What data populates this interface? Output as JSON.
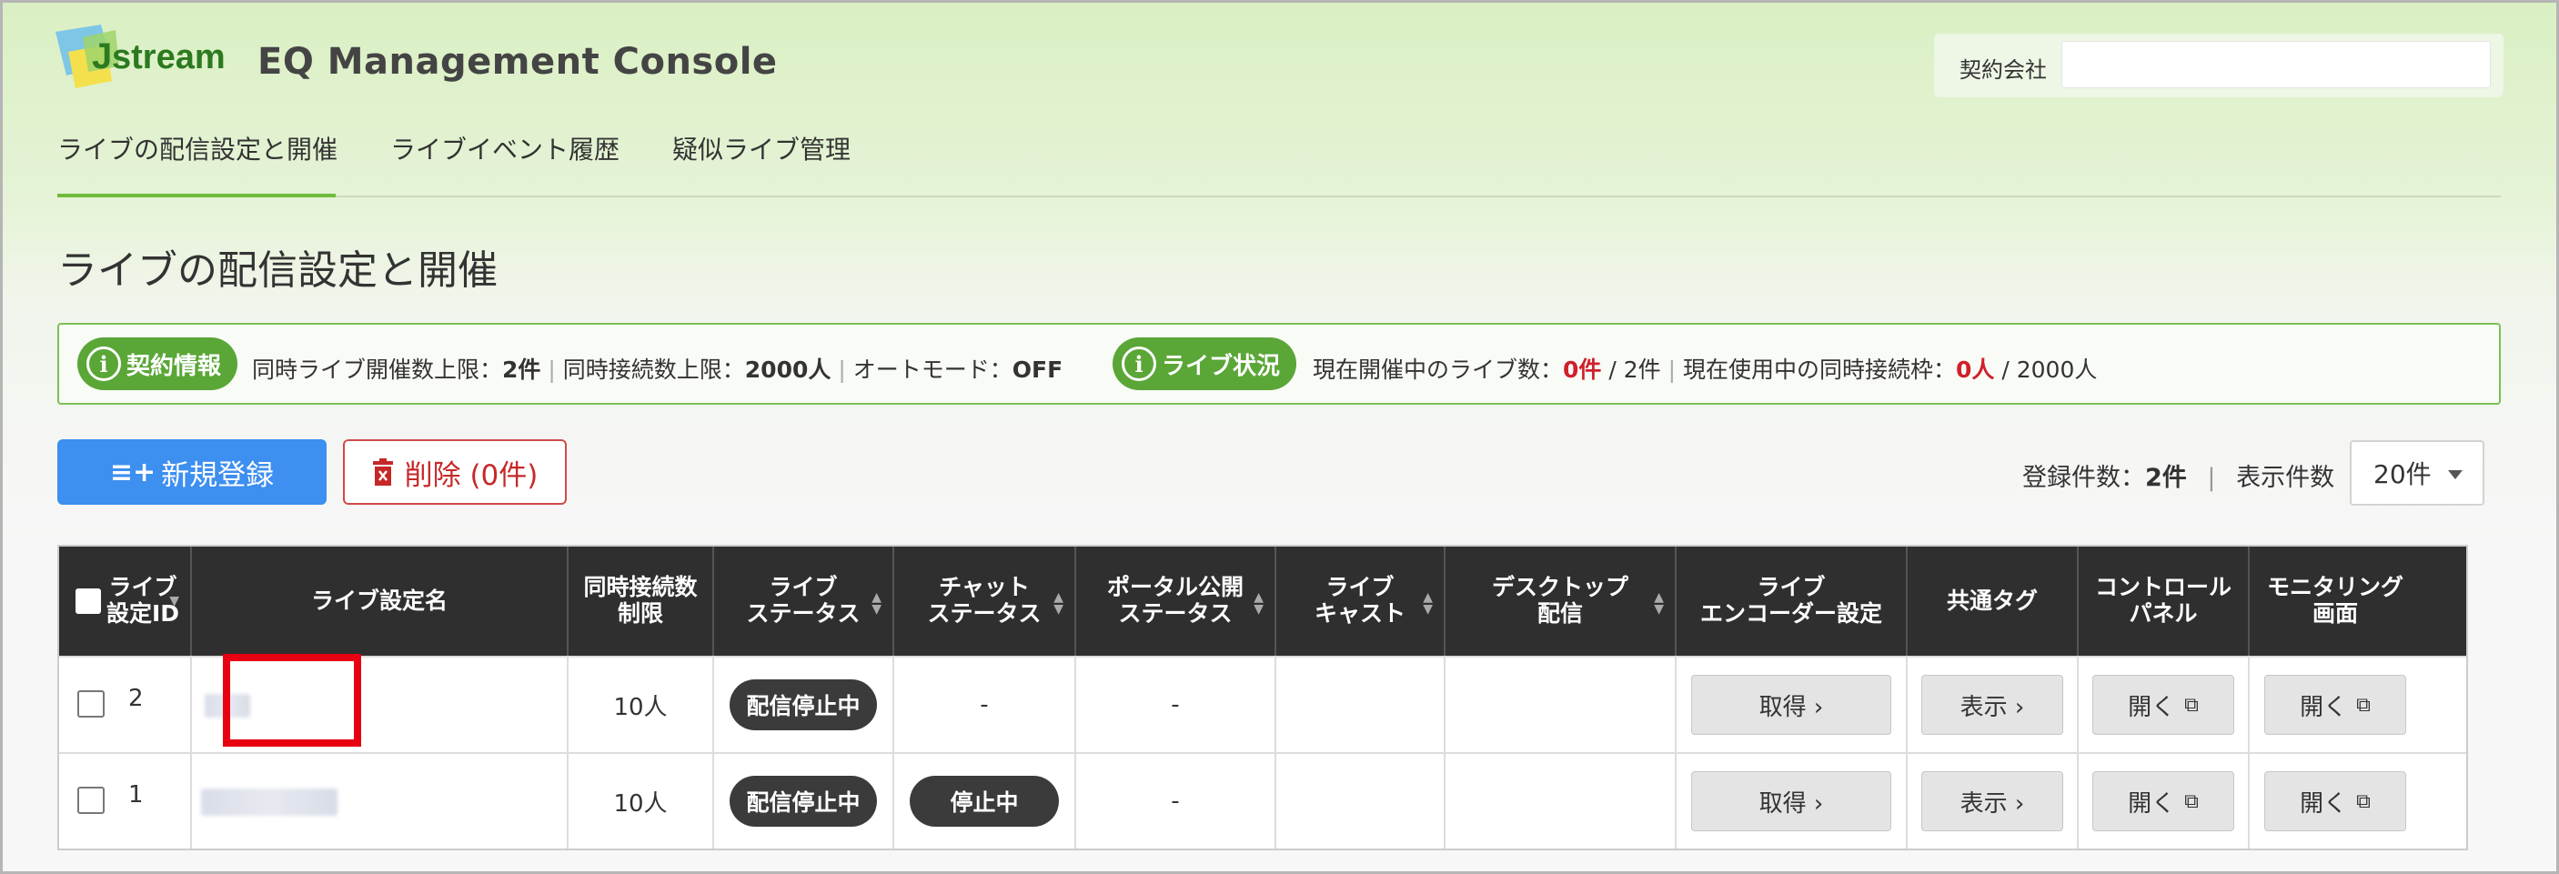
{
  "header": {
    "logo_text": "Jstream",
    "app_title": "EQ Management Console",
    "company_label": "契約会社",
    "company_value": ""
  },
  "nav": {
    "items": [
      {
        "label": "ライブの配信設定と開催"
      },
      {
        "label": "ライブイベント履歴"
      },
      {
        "label": "疑似ライブ管理"
      }
    ]
  },
  "page_title": "ライブの配信設定と開催",
  "contract_info": {
    "pill": "契約情報",
    "max_live_label": "同時ライブ開催数上限：",
    "max_live_value": "2件",
    "max_conn_label": "同時接続数上限：",
    "max_conn_value": "2000人",
    "auto_mode_label": "オートモード：",
    "auto_mode_value": "OFF"
  },
  "live_status": {
    "pill": "ライブ状況",
    "current_live_label": "現在開催中のライブ数：",
    "current_live_value": "0件",
    "current_live_max": "/ 2件",
    "current_conn_label": "現在使用中の同時接続枠：",
    "current_conn_value": "0人",
    "current_conn_max": "/ 2000人"
  },
  "actions": {
    "new_label": "新規登録",
    "delete_label": "削除 (0件)"
  },
  "paging": {
    "registered_label": "登録件数：",
    "registered_value": "2件",
    "separator": "|",
    "display_label": "表示件数",
    "per_page_value": "20件"
  },
  "table": {
    "headers": [
      "ライブ\n設定ID",
      "ライブ設定名",
      "同時接続数\n制限",
      "ライブ\nステータス",
      "チャット\nステータス",
      "ポータル公開\nステータス",
      "ライブ\nキャスト",
      "デスクトップ\n配信",
      "ライブ\nエンコーダー設定",
      "共通タグ",
      "コントロール\nパネル",
      "モニタリング\n画面"
    ],
    "rows": [
      {
        "id": "2",
        "limit": "10人",
        "live_status": "配信停止中",
        "chat_status": "-",
        "portal_status": "-",
        "encoder_btn": "取得 ›",
        "tag_btn": "表示 ›",
        "control_btn": "開く",
        "monitor_btn": "開く"
      },
      {
        "id": "1",
        "limit": "10人",
        "live_status": "配信停止中",
        "chat_status": "停止中",
        "portal_status": "-",
        "encoder_btn": "取得 ›",
        "tag_btn": "表示 ›",
        "control_btn": "開く",
        "monitor_btn": "開く"
      }
    ]
  },
  "colors": {
    "accent_green": "#5aa637",
    "primary_blue": "#3d8ff0",
    "danger_red": "#d0202a",
    "highlight_box": "#e60012"
  }
}
